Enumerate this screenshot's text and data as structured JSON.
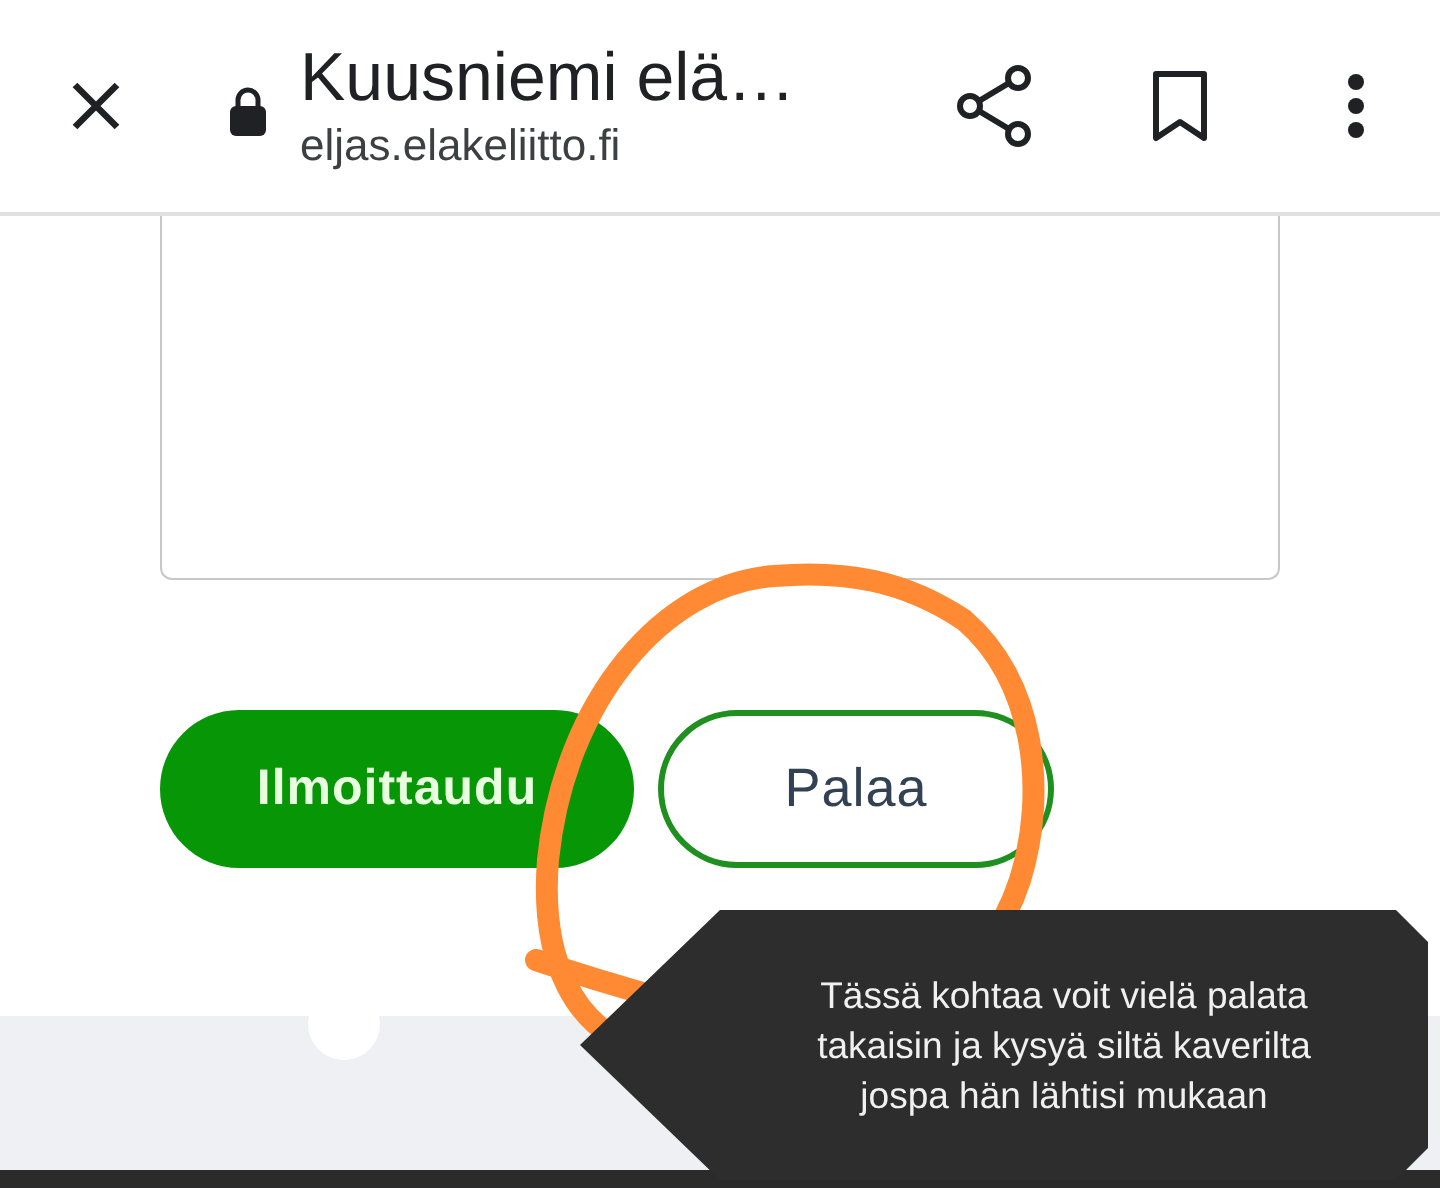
{
  "browser_bar": {
    "title": "Kuusniemi elä…",
    "url": "eljas.elakeliitto.fi"
  },
  "buttons": [
    {
      "label": "Ilmoittaudu",
      "kind": "primary"
    },
    {
      "label": "Palaa",
      "kind": "outline"
    }
  ],
  "tooltip": {
    "text": "Tässä kohtaa voit vielä palata takaisin ja kysyä siltä kaverilta jospa hän lähtisi mukaan"
  }
}
